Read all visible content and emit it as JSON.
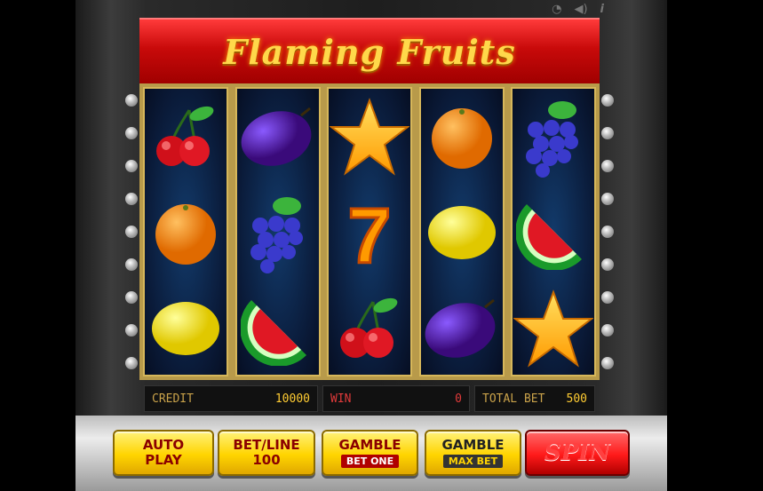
{
  "game": {
    "title": "Flaming Fruits"
  },
  "topbar": {
    "icons": [
      "speed-icon",
      "sound-icon",
      "info-icon"
    ],
    "speed_glyph": "◔",
    "sound_glyph": "◀)",
    "info_glyph": "i"
  },
  "reels": [
    [
      "cherries",
      "orange",
      "lemon"
    ],
    [
      "plum",
      "grapes",
      "watermelon"
    ],
    [
      "star",
      "seven",
      "cherries"
    ],
    [
      "orange",
      "lemon",
      "plum"
    ],
    [
      "grapes",
      "watermelon",
      "star"
    ]
  ],
  "seven_label": "7",
  "panels": {
    "credit": {
      "label": "CREDIT",
      "value": "10000"
    },
    "win": {
      "label": "WIN",
      "value": "0"
    },
    "total_bet": {
      "label": "TOTAL BET",
      "value": "500"
    }
  },
  "buttons": {
    "auto_play": {
      "line1": "AUTO",
      "line2": "PLAY"
    },
    "bet_line": {
      "line1": "BET/LINE",
      "line2": "100"
    },
    "gamble_bet_one": {
      "line1": "GAMBLE",
      "sub": "BET ONE"
    },
    "gamble_max_bet": {
      "line1": "GAMBLE",
      "sub": "MAX BET"
    },
    "spin": {
      "label": "SPIN"
    }
  },
  "colors": {
    "marquee": "#c80a0a",
    "title": "#ffd84a",
    "reel_bg": "#0a1a38",
    "button_yellow": "#ffd400",
    "button_red": "#ff1a1a"
  }
}
